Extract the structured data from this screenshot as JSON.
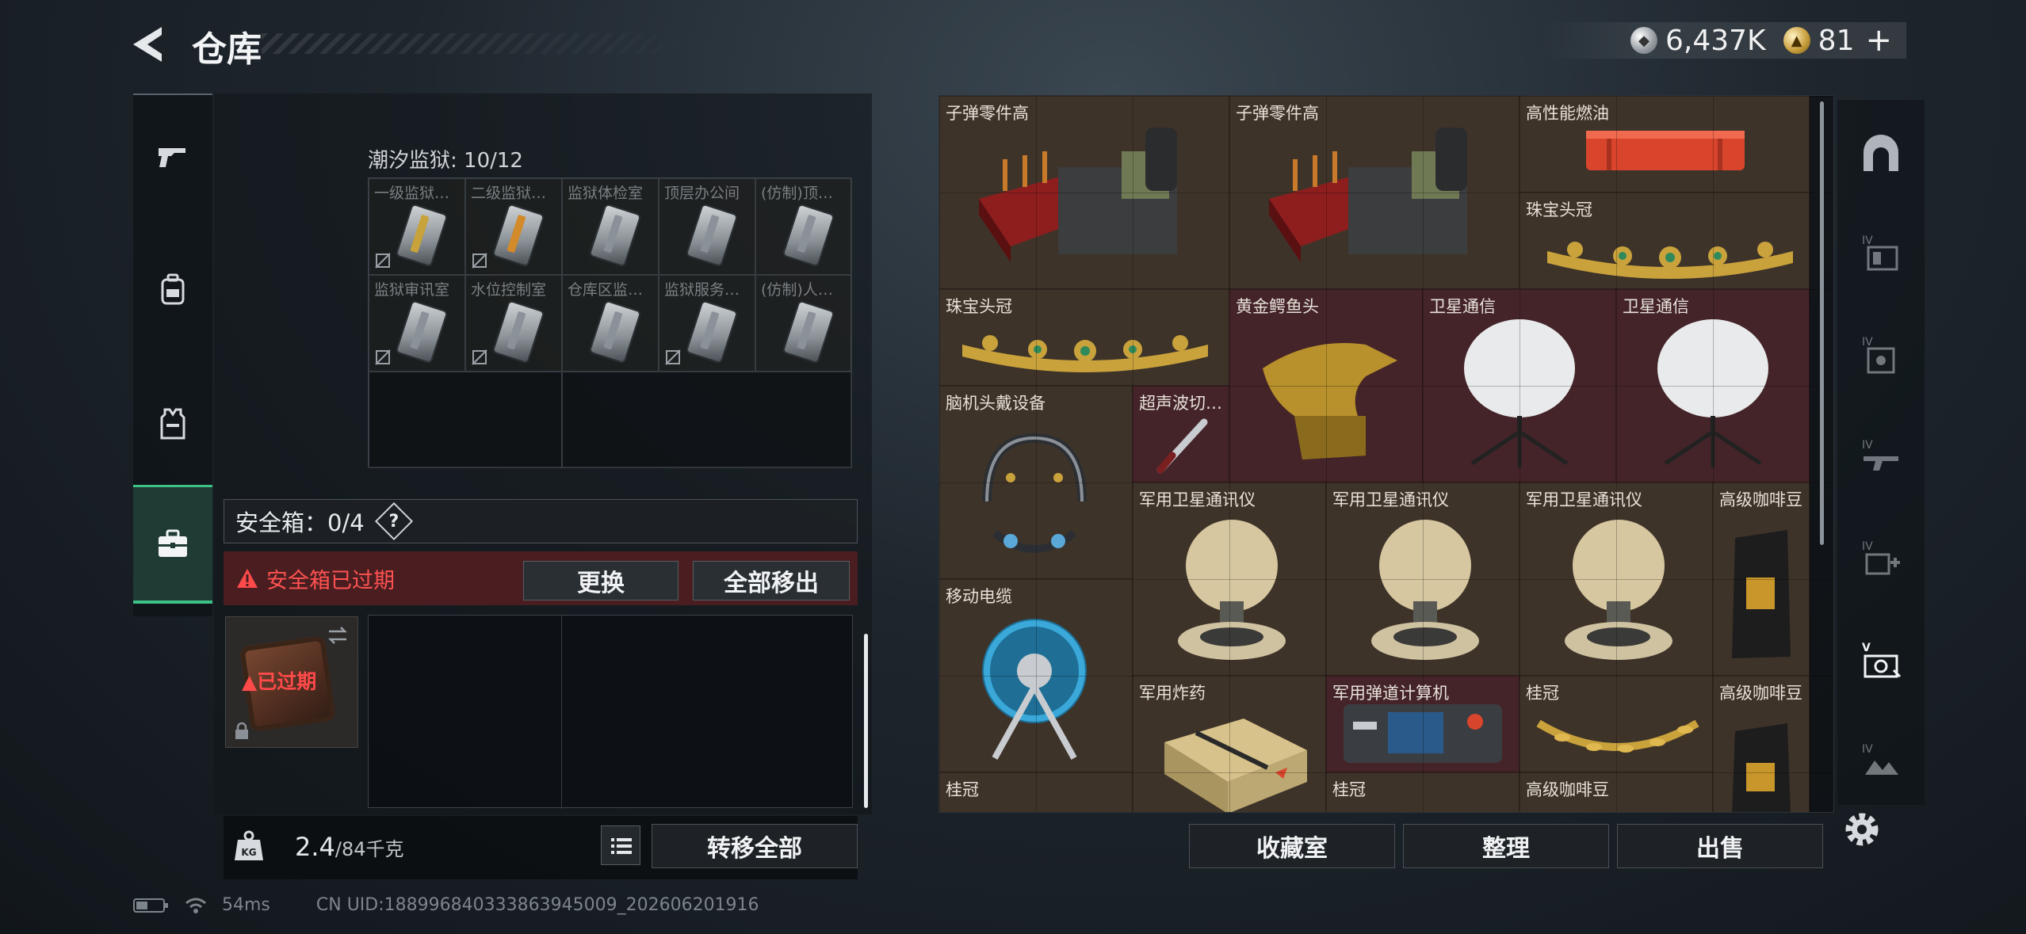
{
  "header": {
    "title": "仓库",
    "currencies": [
      {
        "icon": "silver-coin-icon",
        "value": "6,437K"
      },
      {
        "icon": "gold-coin-icon",
        "value": "81"
      }
    ],
    "plus": "+"
  },
  "left_nav": {
    "items": [
      {
        "name": "weapon",
        "icon": "pistol-icon"
      },
      {
        "name": "gear",
        "icon": "backpack-icon"
      },
      {
        "name": "vest",
        "icon": "vest-icon"
      },
      {
        "name": "safe-box",
        "icon": "briefcase-icon",
        "active": true
      }
    ]
  },
  "key_section": {
    "region": "潮汐监狱: 10/12",
    "keys": [
      {
        "name": "一级监狱…",
        "stripe": "#c8a23a"
      },
      {
        "name": "二级监狱…",
        "stripe": "#d28a2a"
      },
      {
        "name": "监狱体检室",
        "stripe": "#8a9199"
      },
      {
        "name": "顶层办公间",
        "stripe": "#8a9199"
      },
      {
        "name": "(仿制)顶…",
        "stripe": "#8a9199"
      },
      {
        "name": "监狱审讯室",
        "stripe": "#8a9199"
      },
      {
        "name": "水位控制室",
        "stripe": "#8a9199"
      },
      {
        "name": "仓库区监…",
        "stripe": "#8a9199"
      },
      {
        "name": "监狱服务…",
        "stripe": "#8a9199"
      },
      {
        "name": "(仿制)人…",
        "stripe": "#8a9199"
      }
    ]
  },
  "safe_box": {
    "label": "安全箱：0/4",
    "help": "?",
    "expired_warning": "安全箱已过期",
    "replace_button": "更换",
    "remove_all_button": "全部移出",
    "item_status": "已过期"
  },
  "footer_left": {
    "weight_current": "2.4",
    "weight_max": "/84千克",
    "weight_icon_text": "KG",
    "transfer_all_button": "转移全部"
  },
  "inventory": {
    "items": [
      {
        "name": "子弹零件高",
        "bg": "brown"
      },
      {
        "name": "子弹零件高",
        "bg": "brown"
      },
      {
        "name": "高性能燃油",
        "bg": "brown"
      },
      {
        "name": "珠宝头冠",
        "bg": "brown"
      },
      {
        "name": "珠宝头冠",
        "bg": "brown"
      },
      {
        "name": "黄金鳄鱼头",
        "bg": "red"
      },
      {
        "name": "卫星通信",
        "bg": "red"
      },
      {
        "name": "卫星通信",
        "bg": "red"
      },
      {
        "name": "脑机头戴设备",
        "bg": "brown"
      },
      {
        "name": "超声波切…",
        "bg": "red"
      },
      {
        "name": "军用卫星通讯仪",
        "bg": "brown"
      },
      {
        "name": "军用卫星通讯仪",
        "bg": "brown"
      },
      {
        "name": "军用卫星通讯仪",
        "bg": "brown"
      },
      {
        "name": "高级咖啡豆",
        "bg": "brown"
      },
      {
        "name": "移动电缆",
        "bg": "brown"
      },
      {
        "name": "军用炸药",
        "bg": "brown"
      },
      {
        "name": "军用弹道计算机",
        "bg": "red"
      },
      {
        "name": "桂冠",
        "bg": "brown"
      },
      {
        "name": "高级咖啡豆",
        "bg": "brown"
      },
      {
        "name": "桂冠",
        "bg": "brown"
      },
      {
        "name": "桂冠",
        "bg": "brown"
      },
      {
        "name": "高级咖啡豆",
        "bg": "brown"
      }
    ]
  },
  "filters": {
    "items": [
      {
        "name": "all",
        "icon": "helmet-arch-icon"
      },
      {
        "name": "tier-iv-1",
        "icon": "tier-iv-folder-icon",
        "tier": "IV"
      },
      {
        "name": "tier-iv-2",
        "icon": "tier-iv-box-icon",
        "tier": "IV"
      },
      {
        "name": "tier-iv-3",
        "icon": "tier-iv-gun-icon",
        "tier": "IV"
      },
      {
        "name": "tier-iv-4",
        "icon": "tier-iv-medkit-icon",
        "tier": "IV"
      },
      {
        "name": "tier-v",
        "icon": "tier-v-valuables-icon",
        "tier": "V",
        "active": true
      },
      {
        "name": "tier-iv-5",
        "icon": "tier-iv-misc-icon",
        "tier": "IV"
      }
    ]
  },
  "footer_right": {
    "collection_button": "收藏室",
    "sort_button": "整理",
    "sell_button": "出售"
  },
  "status_bar": {
    "ping": "54ms",
    "uid": "CN UID:188996840333863945009_202606201916"
  }
}
